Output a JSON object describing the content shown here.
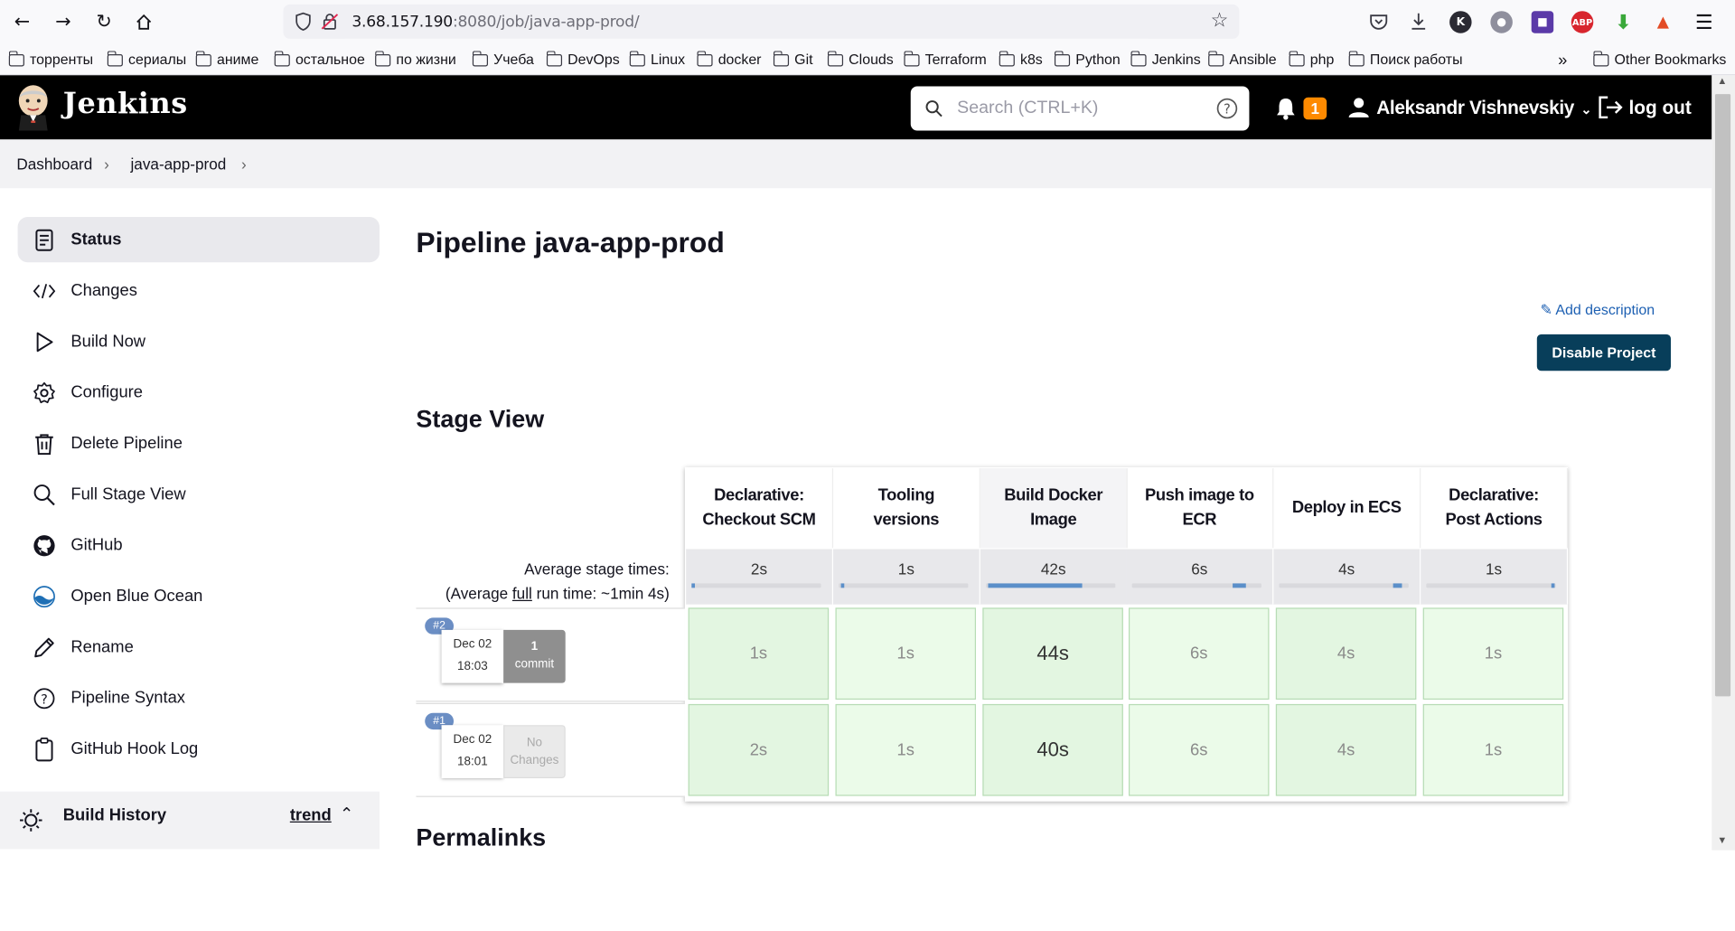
{
  "browser": {
    "url_host": "3.68.157.190",
    "url_path": ":8080/job/java-app-prod/",
    "bookmarks": [
      "торренты",
      "сериалы",
      "аниме",
      "остальное",
      "по жизни",
      "Учеба",
      "DevOps",
      "Linux",
      "docker",
      "Git",
      "Clouds",
      "Terraform",
      "k8s",
      "Python",
      "Jenkins",
      "Ansible",
      "php",
      "Поиск работы"
    ],
    "other_bookmarks": "Other Bookmarks",
    "extensions": {
      "k": "K",
      "abp": "ABP"
    }
  },
  "header": {
    "logo_text": "Jenkins",
    "search_placeholder": "Search (CTRL+K)",
    "notifications_count": "1",
    "user_name": "Aleksandr Vishnevskiy",
    "logout_label": "log out"
  },
  "breadcrumb": {
    "items": [
      "Dashboard",
      "java-app-prod"
    ]
  },
  "sidebar": {
    "items": [
      {
        "label": "Status",
        "icon": "status-icon"
      },
      {
        "label": "Changes",
        "icon": "code-icon"
      },
      {
        "label": "Build Now",
        "icon": "play-icon"
      },
      {
        "label": "Configure",
        "icon": "gear-icon"
      },
      {
        "label": "Delete Pipeline",
        "icon": "trash-icon"
      },
      {
        "label": "Full Stage View",
        "icon": "search-icon"
      },
      {
        "label": "GitHub",
        "icon": "github-icon"
      },
      {
        "label": "Open Blue Ocean",
        "icon": "blue-ocean-icon"
      },
      {
        "label": "Rename",
        "icon": "pencil-icon"
      },
      {
        "label": "Pipeline Syntax",
        "icon": "help-icon"
      },
      {
        "label": "GitHub Hook Log",
        "icon": "clipboard-icon"
      }
    ],
    "build_history": {
      "title": "Build History",
      "trend": "trend"
    }
  },
  "main": {
    "title": "Pipeline java-app-prod",
    "add_description": "Add description",
    "disable_project": "Disable Project",
    "stage_view_title": "Stage View",
    "permalinks_title": "Permalinks"
  },
  "stage_view": {
    "avg_label": "Average stage times:",
    "avg_full_prefix": "(Average ",
    "avg_full_word": "full",
    "avg_full_suffix": " run time: ~1min 4s)",
    "stages": [
      {
        "name_1": "Declarative:",
        "name_2": "Checkout SCM",
        "avg": "2s",
        "bar_fill": 0.02
      },
      {
        "name_1": "Tooling",
        "name_2": "versions",
        "avg": "1s",
        "bar_fill": 0.01
      },
      {
        "name_1": "Build Docker",
        "name_2": "Image",
        "avg": "42s",
        "bar_fill": 0.72
      },
      {
        "name_1": "Push image to",
        "name_2": "ECR",
        "avg": "6s",
        "bar_fill": 0.1
      },
      {
        "name_1": "Deploy in ECS",
        "name_2": "",
        "avg": "4s",
        "bar_fill": 0.07
      },
      {
        "name_1": "Declarative:",
        "name_2": "Post Actions",
        "avg": "1s",
        "bar_fill": 0.02
      }
    ],
    "runs": [
      {
        "id": "#2",
        "date": "Dec 02",
        "time": "18:03",
        "changes_1": "1",
        "changes_2": "commit",
        "durations": [
          "1s",
          "1s",
          "44s",
          "6s",
          "4s",
          "1s"
        ]
      },
      {
        "id": "#1",
        "date": "Dec 02",
        "time": "18:01",
        "changes_1": "No",
        "changes_2": "Changes",
        "durations": [
          "2s",
          "1s",
          "40s",
          "6s",
          "4s",
          "1s"
        ]
      }
    ]
  }
}
